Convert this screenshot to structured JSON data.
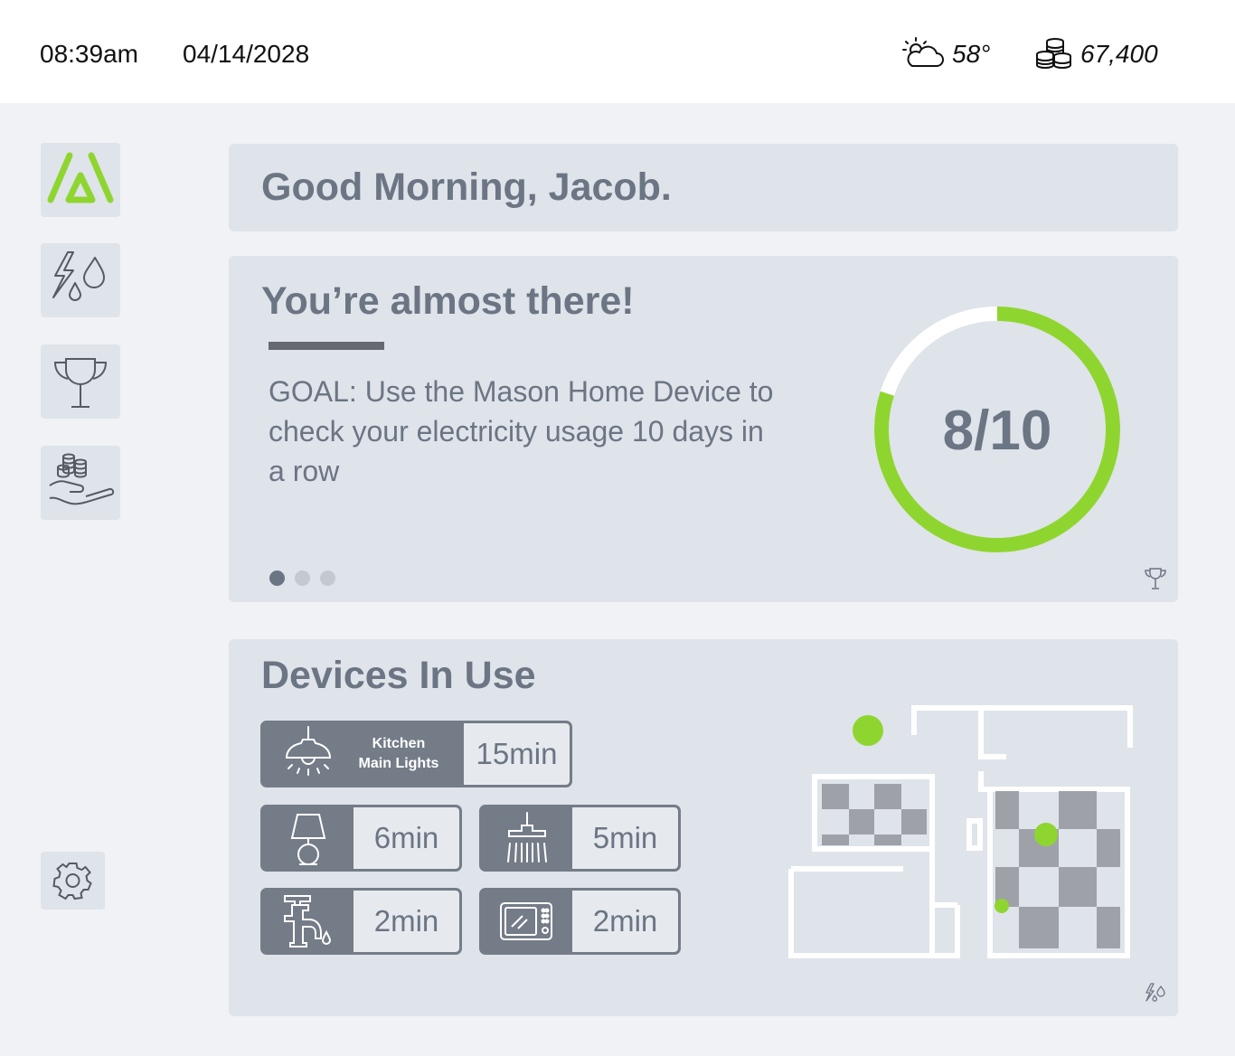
{
  "status_bar": {
    "time": "08:39am",
    "date": "04/14/2028",
    "weather_icon": "partly-cloudy-icon",
    "temperature": "58°",
    "coins_icon": "coin-stack-icon",
    "coins": "67,400"
  },
  "sidebar": {
    "items": [
      {
        "icon": "home-logo-icon",
        "active": true
      },
      {
        "icon": "energy-water-icon"
      },
      {
        "icon": "trophy-icon"
      },
      {
        "icon": "rewards-hand-icon"
      }
    ],
    "settings_icon": "gear-icon"
  },
  "greeting": "Good Morning, Jacob.",
  "goal_card": {
    "title": "You’re almost there!",
    "text": "GOAL: Use the Mason Home Device to check your electricity usage 10 days in a row",
    "progress_label": "8/10",
    "progress_fraction": 0.8,
    "pager": {
      "count": 3,
      "active": 0
    },
    "corner_icon": "trophy-icon"
  },
  "devices_card": {
    "title": "Devices In Use",
    "devices": [
      {
        "name": "Kitchen Main Lights",
        "line1": "Kitchen",
        "line2": "Main Lights",
        "time": "15min",
        "icon": "pendant-light-icon"
      },
      {
        "time": "6min",
        "icon": "table-lamp-icon"
      },
      {
        "time": "5min",
        "icon": "shower-icon"
      },
      {
        "time": "2min",
        "icon": "faucet-icon"
      },
      {
        "time": "2min",
        "icon": "microwave-icon"
      }
    ],
    "corner_icon": "energy-water-icon"
  },
  "colors": {
    "accent": "#8fd530",
    "card": "#dfe3ea",
    "text": "#6b7583",
    "device_dark": "#747c88"
  }
}
